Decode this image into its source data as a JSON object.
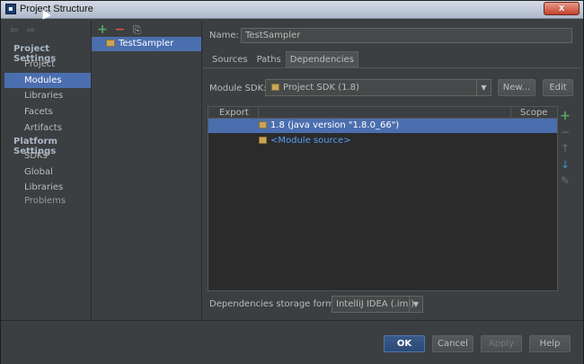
{
  "window": {
    "title": "Project Structure",
    "close_label": "x"
  },
  "nav": {
    "arrows": [
      "⇦",
      "⇨"
    ],
    "groups": {
      "project_settings": "Project Settings",
      "platform_settings": "Platform Settings"
    },
    "items": {
      "project": "Project",
      "modules": "Modules",
      "libraries": "Libraries",
      "facets": "Facets",
      "artifacts": "Artifacts",
      "sdks": "SDKs",
      "global_libraries": "Global Libraries",
      "problems": "Problems"
    }
  },
  "tree": {
    "toolbar": [
      "+",
      "−",
      "⎘"
    ],
    "module": "TestSampler"
  },
  "details": {
    "name_label": "Name:",
    "name_value": "TestSampler",
    "tabs": [
      "Sources",
      "Paths",
      "Dependencies"
    ],
    "module_sdk_label": "Module SDK:",
    "module_sdk_value": "Project SDK (1.8)",
    "new_button": "New...",
    "edit_button": "Edit",
    "table": {
      "headers": [
        "Export",
        "Scope"
      ],
      "rows": [
        {
          "label": "1.8 (java version \"1.8.0_66\")"
        },
        {
          "label": "<Module source>"
        }
      ]
    },
    "side_tools": [
      "+",
      "−",
      "↑",
      "↓",
      "✎"
    ],
    "storage_label": "Dependencies storage format:",
    "storage_value": "IntelliJ IDEA (.iml)"
  },
  "buttons": {
    "ok": "OK",
    "cancel": "Cancel",
    "apply": "Apply",
    "help": "Help"
  },
  "colors": {
    "selection": "#4b6eaf",
    "background": "#3c3f41",
    "link": "#589df6"
  }
}
